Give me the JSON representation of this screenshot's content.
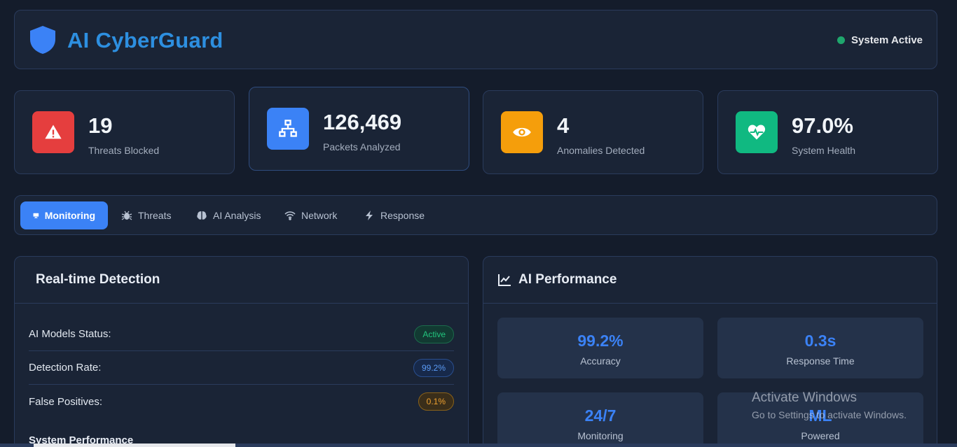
{
  "header": {
    "title": "AI CyberGuard",
    "status": "System Active"
  },
  "stats": [
    {
      "value": "19",
      "label": "Threats Blocked",
      "icon": "alert-triangle-icon",
      "color": "#e53e3e"
    },
    {
      "value": "126,469",
      "label": "Packets Analyzed",
      "icon": "network-icon",
      "color": "#3b82f6"
    },
    {
      "value": "4",
      "label": "Anomalies Detected",
      "icon": "eye-icon",
      "color": "#f59e0b"
    },
    {
      "value": "97.0%",
      "label": "System Health",
      "icon": "heartbeat-icon",
      "color": "#10b981"
    }
  ],
  "tabs": [
    {
      "label": "Monitoring",
      "icon": "monitor-icon"
    },
    {
      "label": "Threats",
      "icon": "bug-icon"
    },
    {
      "label": "AI Analysis",
      "icon": "brain-icon"
    },
    {
      "label": "Network",
      "icon": "wifi-icon"
    },
    {
      "label": "Response",
      "icon": "bolt-icon"
    }
  ],
  "detection": {
    "title": "Real-time Detection",
    "rows": [
      {
        "label": "AI Models Status:",
        "value": "Active"
      },
      {
        "label": "Detection Rate:",
        "value": "99.2%"
      },
      {
        "label": "False Positives:",
        "value": "0.1%"
      }
    ],
    "subheading": "System Performance"
  },
  "performance": {
    "title": "AI Performance",
    "metrics": [
      {
        "value": "99.2%",
        "label": "Accuracy"
      },
      {
        "value": "0.3s",
        "label": "Response Time"
      },
      {
        "value": "24/7",
        "label": "Monitoring"
      },
      {
        "value": "ML",
        "label": "Powered"
      }
    ]
  },
  "watermark": {
    "title": "Activate Windows",
    "subtitle": "Go to Settings to activate Windows."
  }
}
